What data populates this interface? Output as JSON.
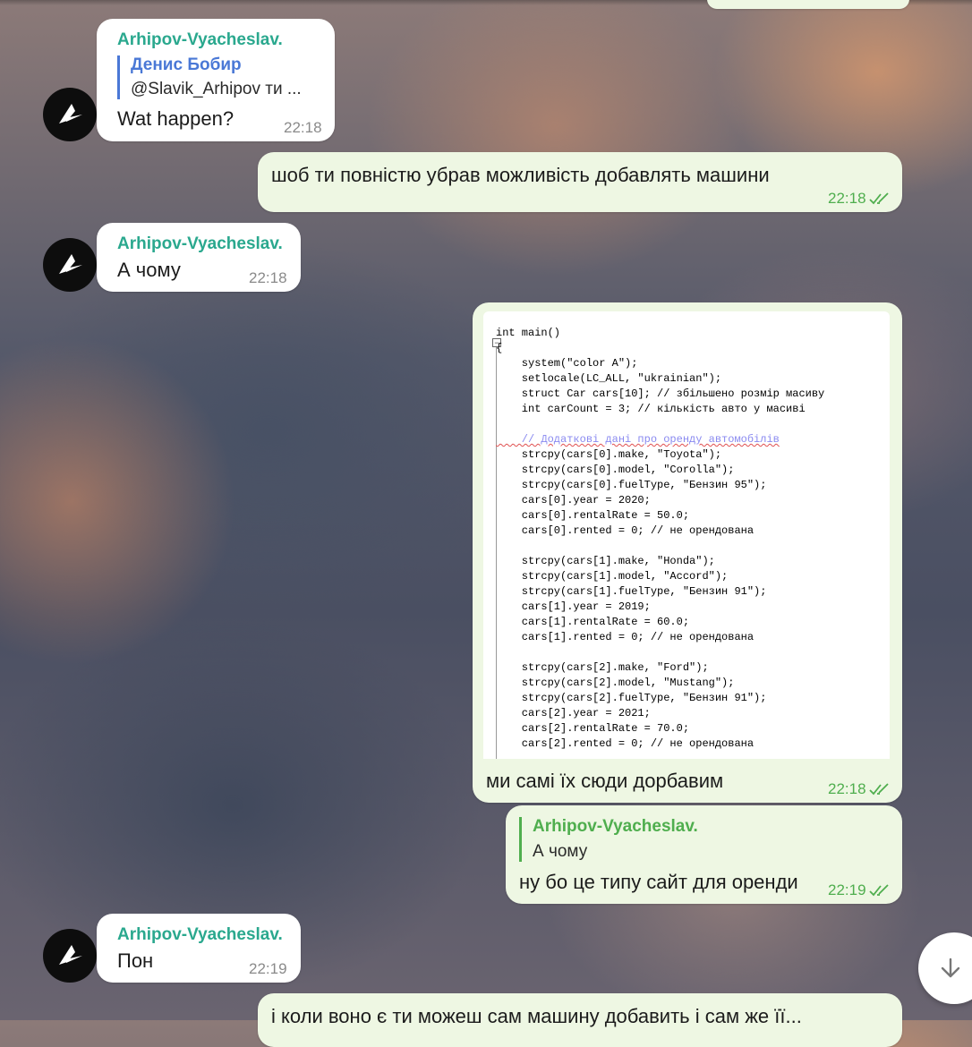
{
  "messages": [
    {
      "sender": "Arhipov-Vyacheslav.",
      "reply_to": {
        "name": "Денис Бобир",
        "text": "@Slavik_Arhipov ти ..."
      },
      "text": "Wat happen?",
      "time": "22:18"
    },
    {
      "text": "шоб ти повністю убрав можливість добавлять машини",
      "time": "22:18"
    },
    {
      "sender": "Arhipov-Vyacheslav.",
      "text": "А чому",
      "time": "22:18"
    },
    {
      "caption": "ми самі їх сюди дорбавим",
      "time": "22:18",
      "code": [
        "int main()",
        "{",
        "    system(\"color A\");",
        "    setlocale(LC_ALL, \"ukrainian\");",
        "    struct Car cars[10]; // збільшено розмір масиву",
        "    int carCount = 3; // кількість авто у масиві",
        "",
        "    // Додаткові дані про оренду автомобілів",
        "    strcpy(cars[0].make, \"Toyota\");",
        "    strcpy(cars[0].model, \"Corolla\");",
        "    strcpy(cars[0].fuelType, \"Бензин 95\");",
        "    cars[0].year = 2020;",
        "    cars[0].rentalRate = 50.0;",
        "    cars[0].rented = 0; // не орендована",
        "",
        "    strcpy(cars[1].make, \"Honda\");",
        "    strcpy(cars[1].model, \"Accord\");",
        "    strcpy(cars[1].fuelType, \"Бензин 91\");",
        "    cars[1].year = 2019;",
        "    cars[1].rentalRate = 60.0;",
        "    cars[1].rented = 0; // не орендована",
        "",
        "    strcpy(cars[2].make, \"Ford\");",
        "    strcpy(cars[2].model, \"Mustang\");",
        "    strcpy(cars[2].fuelType, \"Бензин 91\");",
        "    cars[2].year = 2021;",
        "    cars[2].rentalRate = 70.0;",
        "    cars[2].rented = 0; // не орендована"
      ]
    },
    {
      "reply_to": {
        "name": "Arhipov-Vyacheslav.",
        "text": "А чому"
      },
      "text": "ну бо це типу сайт для оренди",
      "time": "22:19"
    },
    {
      "sender": "Arhipov-Vyacheslav.",
      "text": "Пон",
      "time": "22:19"
    },
    {
      "text": "і коли воно є ти можеш сам машину добавить і сам же її..."
    }
  ],
  "icons": {
    "avatar": "arrow-logo-icon",
    "read_receipt": "double-check-icon",
    "scroll_down": "arrow-down-icon"
  },
  "colors": {
    "incoming_bubble": "#ffffff",
    "outgoing_bubble": "#eef7e3",
    "sender_name": "#2aa88e",
    "reply_name": "#4a78d6",
    "outgoing_time": "#4fae4e"
  }
}
